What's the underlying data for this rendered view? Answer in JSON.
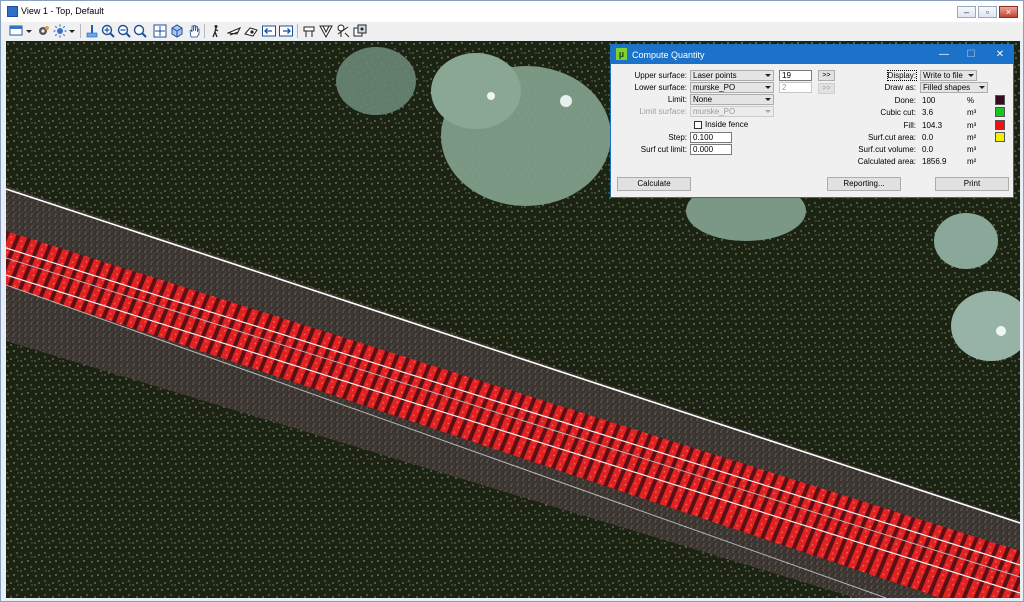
{
  "window": {
    "title": "View 1 - Top, Default"
  },
  "toolbar": {
    "icons": [
      "view-options-icon",
      "dropdown-arrow-icon",
      "settings-icon",
      "brightness-icon",
      "dropdown-arrow-icon",
      "update-icon",
      "zoom-in-icon",
      "zoom-out-icon",
      "fit-view-icon",
      "pan-icon",
      "rotate-view-icon",
      "hand-icon",
      "walk-icon",
      "fly-icon",
      "camera-icon",
      "previous-view-icon",
      "next-view-icon",
      "clip-volume-icon",
      "clip-mask-icon",
      "view-settings-icon",
      "copy-view-icon"
    ]
  },
  "dialog": {
    "title": "Compute Quantity",
    "labels": {
      "upper_surface": "Upper surface:",
      "lower_surface": "Lower surface:",
      "limit": "Limit:",
      "limit_surface": "Limit surface:",
      "inside_fence": "Inside fence",
      "step": "Step:",
      "surf_cut_limit": "Surf cut limit:",
      "display": "Display:",
      "draw_as": "Draw as:",
      "done": "Done:",
      "cubic_cut": "Cubic cut:",
      "fill": "Fill:",
      "surf_cut_area": "Surf.cut area:",
      "surf_cut_volume": "Surf.cut volume:",
      "calculated_area": "Calculated area:"
    },
    "fields": {
      "upper_surface": "Laser points",
      "lower_surface": "murske_PO",
      "limit": "None",
      "limit_surface": "murske_PO",
      "upper_class": "19",
      "lower_class": "2",
      "step": "0.100",
      "surf_cut_limit": "0.000",
      "display": "Write to file",
      "draw_as": "Filled shapes"
    },
    "arrows": {
      "upper": ">>",
      "lower": ">>"
    },
    "results": {
      "done": "100",
      "cubic_cut": "3.6",
      "fill": "104.3",
      "surf_cut_area": "0.0",
      "surf_cut_volume": "0.0",
      "calculated_area": "1856.9"
    },
    "units": {
      "done": "%",
      "cubic_cut": "m³",
      "fill": "m³",
      "surf_cut_area": "m²",
      "surf_cut_volume": "m³",
      "calculated_area": "m²"
    },
    "colors": {
      "done": "#3a0a1e",
      "cubic_cut": "#16c81a",
      "fill": "#ee1111",
      "surf_cut_area": "#f5f000"
    },
    "buttons": {
      "calculate": "Calculate",
      "reporting": "Reporting...",
      "print": "Print"
    }
  }
}
